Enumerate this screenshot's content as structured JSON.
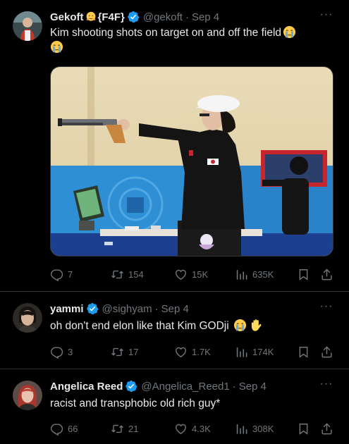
{
  "tweets": [
    {
      "name": "Gekoft",
      "name_suffix": "{F4F}",
      "handle": "@gekoft",
      "time": "Sep 4",
      "text": "Kim shooting shots on target on and off the field",
      "replies": "7",
      "retweets": "154",
      "likes": "15K",
      "views": "635K"
    },
    {
      "name": "yammi",
      "handle": "@sighyam",
      "time": "Sep 4",
      "text": "oh don't end elon like that Kim GODji",
      "replies": "3",
      "retweets": "17",
      "likes": "1.7K",
      "views": "174K"
    },
    {
      "name": "Angelica Reed",
      "handle": "@Angelica_Reed1",
      "time": "Sep 4",
      "text": "racist and transphobic old rich guy*",
      "replies": "66",
      "retweets": "21",
      "likes": "4.3K",
      "views": "308K"
    }
  ],
  "icons": {
    "verified": "verified-badge-icon",
    "reply": "reply-icon",
    "retweet": "retweet-icon",
    "like": "like-icon",
    "views": "views-icon",
    "bookmark": "bookmark-icon",
    "share": "share-icon",
    "more": "more-icon"
  },
  "colors": {
    "background": "#000000",
    "text": "#e7e9ea",
    "muted": "#71767b",
    "verified": "#1d9bf0",
    "divider": "#2f3336"
  }
}
